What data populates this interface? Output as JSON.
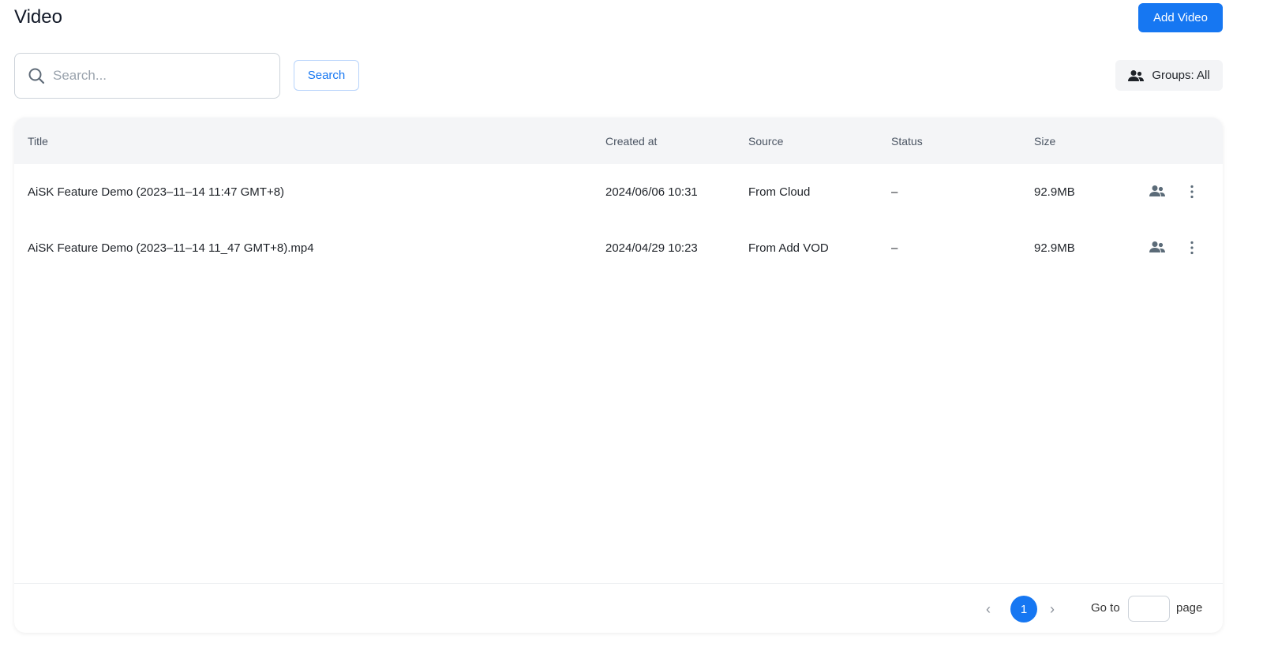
{
  "header": {
    "title": "Video",
    "add_label": "Add Video"
  },
  "search": {
    "placeholder": "Search...",
    "value": "",
    "button": "Search"
  },
  "groups": {
    "label": "Groups: All"
  },
  "table": {
    "columns": [
      "Title",
      "Created at",
      "Source",
      "Status",
      "Size"
    ],
    "rows": [
      {
        "title": "AiSK Feature Demo (2023–11–14 11:47 GMT+8)",
        "created": "2024/06/06 10:31",
        "source": "From Cloud",
        "status": "–",
        "size": "92.9MB"
      },
      {
        "title": "AiSK Feature Demo (2023–11–14 11_47 GMT+8).mp4",
        "created": "2024/04/29 10:23",
        "source": "From Add VOD",
        "status": "–",
        "size": "92.9MB"
      }
    ]
  },
  "pagination": {
    "current": "1",
    "goto": "Go to",
    "page": "page",
    "prev": "‹",
    "next": "›"
  }
}
